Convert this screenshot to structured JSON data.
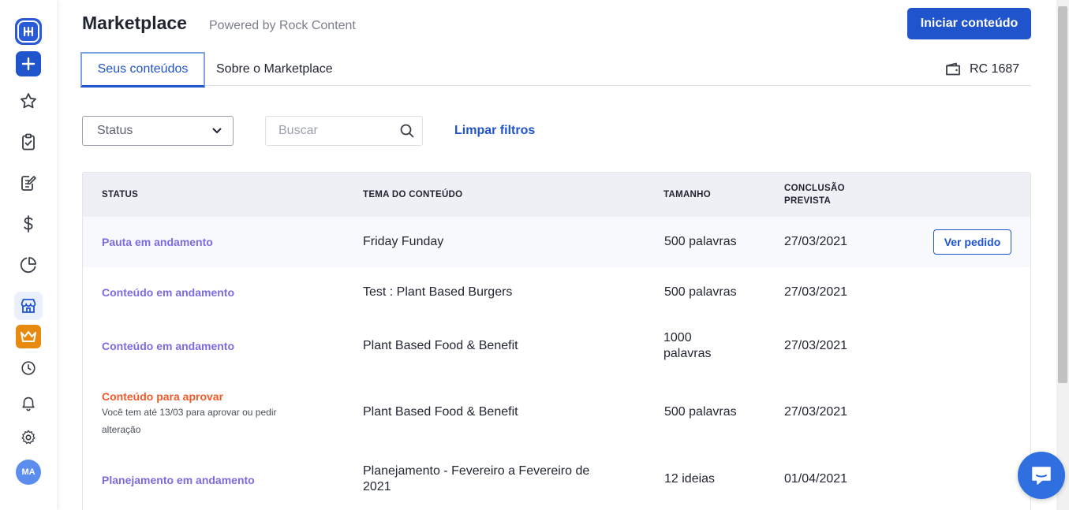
{
  "header": {
    "title": "Marketplace",
    "subtitle": "Powered by Rock Content",
    "primary_button": "Iniciar conteúdo"
  },
  "tabs": [
    {
      "label": "Seus conteúdos",
      "active": true
    },
    {
      "label": "Sobre o Marketplace",
      "active": false
    }
  ],
  "credits": {
    "icon": "wallet-icon",
    "label": "RC 1687"
  },
  "filters": {
    "status_select": "Status",
    "search_placeholder": "Buscar",
    "clear_label": "Limpar filtros"
  },
  "table": {
    "columns": [
      "STATUS",
      "TEMA DO CONTEÚDO",
      "TAMANHO",
      "CONCLUSÃO\nPREVISTA"
    ],
    "rows": [
      {
        "status": "Pauta em andamento",
        "status_color": "#7b6be0",
        "note": "",
        "theme": "Friday Funday",
        "size": "500 palavras",
        "date": "27/03/2021",
        "action": "Ver pedido"
      },
      {
        "status": "Conteúdo em andamento",
        "status_color": "#7b6be0",
        "note": "",
        "theme": "Test : Plant Based Burgers",
        "size": "500 palavras",
        "date": "27/03/2021",
        "action": ""
      },
      {
        "status": "Conteúdo em andamento",
        "status_color": "#7b6be0",
        "note": "",
        "theme": "Plant Based Food & Benefit",
        "size": "1000 palavras",
        "date": "27/03/2021",
        "action": ""
      },
      {
        "status": "Conteúdo para aprovar",
        "status_color": "#f05a28",
        "note": "Você tem até 13/03 para aprovar ou pedir alteração",
        "theme": "Plant Based Food & Benefit",
        "size": "500 palavras",
        "date": "27/03/2021",
        "action": ""
      },
      {
        "status": "Planejamento em andamento",
        "status_color": "#7b6be0",
        "note": "",
        "theme": "Planejamento - Fevereiro a Fevereiro de 2021",
        "size": "12 ideias",
        "date": "01/04/2021",
        "action": ""
      }
    ]
  },
  "sidebar": {
    "avatar_initials": "MA",
    "icons": [
      "logo-icon",
      "plus-icon",
      "star-icon",
      "clipboard-check-icon",
      "edit-document-icon",
      "dollar-icon",
      "pie-chart-icon",
      "store-icon",
      "crown-icon",
      "clock-icon",
      "bell-icon",
      "gear-icon"
    ]
  },
  "colors": {
    "accent": "#1f54cc",
    "status_progress": "#7b6be0",
    "status_approve": "#f05a28"
  }
}
